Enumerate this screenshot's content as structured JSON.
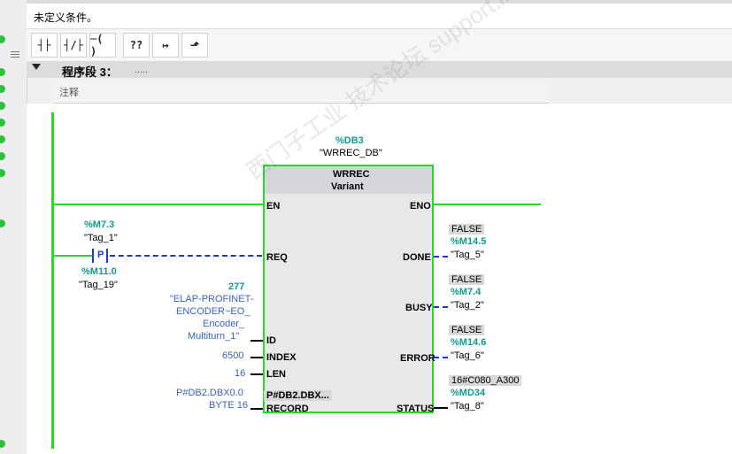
{
  "condition": {
    "text": "未定义条件。"
  },
  "toolbar": {
    "buttons": [
      {
        "name": "no-contact-button",
        "glyph": "┤├"
      },
      {
        "name": "nc-contact-button",
        "glyph": "┤/├"
      },
      {
        "name": "coil-button",
        "glyph": "─( )"
      },
      {
        "name": "empty-box-button",
        "glyph": "??"
      },
      {
        "name": "open-branch-button",
        "glyph": "↦"
      },
      {
        "name": "close-branch-button",
        "glyph": "⬏"
      }
    ]
  },
  "network": {
    "title": "程序段 3：",
    "title_extra": ".....",
    "comment": "注释"
  },
  "block": {
    "db_address": "%DB3",
    "db_name": "\"WRREC_DB\"",
    "type": "WRREC",
    "variant": "Variant",
    "pins_left": [
      "EN",
      "REQ",
      "ID",
      "INDEX",
      "LEN",
      "RECORD"
    ],
    "pins_right": [
      "ENO",
      "DONE",
      "BUSY",
      "ERROR",
      "STATUS"
    ],
    "record_hint": "P#DB2.DBX..."
  },
  "inputs": {
    "req_contact_addr": "%M7.3",
    "req_contact_tag": "\"Tag_1\"",
    "req_contact_type": "P",
    "edge_addr": "%M11.0",
    "edge_tag": "\"Tag_19\"",
    "id_value": "277",
    "id_name_lines": [
      "\"ELAP-PROFINET-",
      "ENCODER~EO_",
      "Encoder_",
      "Multiturn_1\""
    ],
    "index_value": "6500",
    "len_value": "16",
    "record_line1": "P#DB2.DBX0.0",
    "record_line2": "BYTE 16"
  },
  "outputs": {
    "done_value": "FALSE",
    "done_addr": "%M14.5",
    "done_tag": "\"Tag_5\"",
    "busy_value": "FALSE",
    "busy_addr": "%M7.4",
    "busy_tag": "\"Tag_2\"",
    "error_value": "FALSE",
    "error_addr": "%M14.6",
    "error_tag": "\"Tag_6\"",
    "status_value": "16#C080_A300",
    "status_addr": "%MD34",
    "status_tag": "\"Tag_8\""
  },
  "watermark": {
    "text": "西门子工业 技术论坛 support.industry.siemens.com/cs"
  }
}
